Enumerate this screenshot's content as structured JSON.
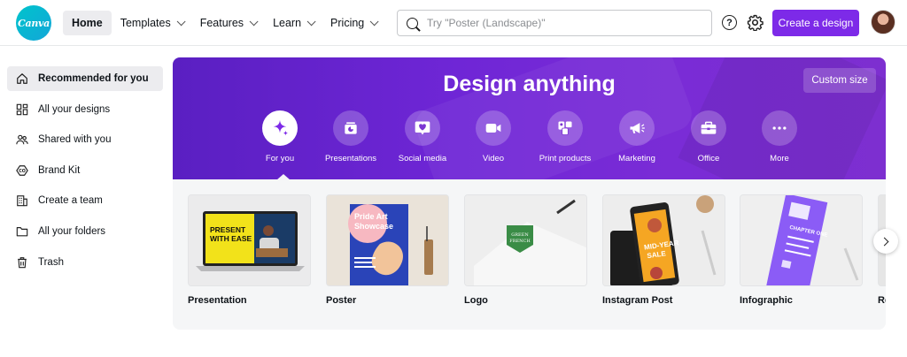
{
  "brand": {
    "logo_text": "Canva"
  },
  "nav": {
    "home": "Home",
    "templates": "Templates",
    "features": "Features",
    "learn": "Learn",
    "pricing": "Pricing"
  },
  "search": {
    "placeholder": "Try \"Poster (Landscape)\""
  },
  "header": {
    "help_glyph": "?",
    "create_label": "Create a design",
    "accent": "#7d2ae8"
  },
  "sidebar": {
    "items": [
      {
        "label": "Recommended for you",
        "icon": "home-icon"
      },
      {
        "label": "All your designs",
        "icon": "grid-icon"
      },
      {
        "label": "Shared with you",
        "icon": "people-icon"
      },
      {
        "label": "Brand Kit",
        "icon": "brand-kit-icon"
      },
      {
        "label": "Create a team",
        "icon": "building-icon"
      },
      {
        "label": "All your folders",
        "icon": "folder-icon"
      },
      {
        "label": "Trash",
        "icon": "trash-icon"
      }
    ]
  },
  "hero": {
    "title": "Design anything",
    "custom_size": "Custom size",
    "categories": [
      {
        "label": "For you",
        "icon": "sparkle-icon"
      },
      {
        "label": "Presentations",
        "icon": "presentation-icon"
      },
      {
        "label": "Social media",
        "icon": "heart-icon"
      },
      {
        "label": "Video",
        "icon": "video-icon"
      },
      {
        "label": "Print products",
        "icon": "print-icon"
      },
      {
        "label": "Marketing",
        "icon": "megaphone-icon"
      },
      {
        "label": "Office",
        "icon": "briefcase-icon"
      },
      {
        "label": "More",
        "icon": "more-icon"
      }
    ]
  },
  "templates": [
    {
      "name": "Presentation",
      "thumb_text": "PRESENT WITH EASE"
    },
    {
      "name": "Poster",
      "thumb_text": "Pride Art Showcase"
    },
    {
      "name": "Logo",
      "thumb_text": "GREEN FRENCH"
    },
    {
      "name": "Instagram Post",
      "thumb_text": "MID-YEAR SALE"
    },
    {
      "name": "Infographic",
      "thumb_text": "CHAPTER ONE"
    },
    {
      "name": "Re",
      "thumb_text": ""
    }
  ]
}
